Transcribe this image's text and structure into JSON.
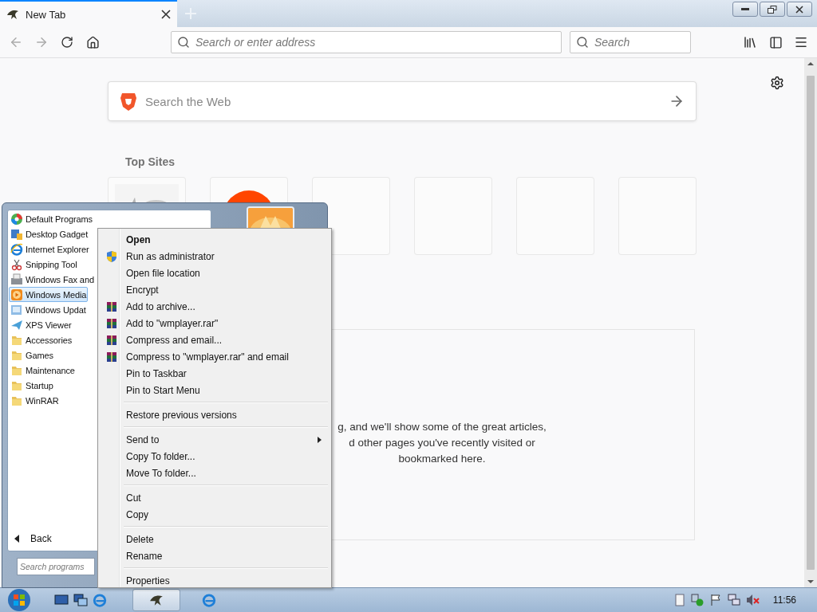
{
  "browser": {
    "tab": {
      "title": "New Tab",
      "selected": true
    },
    "address": {
      "placeholder": "Search or enter address"
    },
    "search": {
      "placeholder": "Search"
    },
    "web_search": {
      "placeholder": "Search the Web"
    },
    "top_sites": {
      "heading": "Top Sites",
      "tiles": [
        {
          "kind": "picture"
        },
        {
          "kind": "logo"
        },
        {
          "kind": "empty"
        },
        {
          "kind": "empty"
        },
        {
          "kind": "empty"
        },
        {
          "kind": "empty"
        }
      ]
    },
    "highlights": {
      "lines": [
        "g, and we'll show some of the great articles,",
        "d other pages you've recently visited or",
        "bookmarked here."
      ]
    }
  },
  "start_menu": {
    "programs": [
      {
        "label": "Default Programs",
        "kind": "default",
        "selected": false
      },
      {
        "label": "Desktop Gadget",
        "kind": "gadget",
        "selected": false
      },
      {
        "label": "Internet Explorer",
        "kind": "ie",
        "selected": false
      },
      {
        "label": "Snipping Tool",
        "kind": "snip",
        "selected": false
      },
      {
        "label": "Windows Fax and",
        "kind": "fax",
        "selected": false
      },
      {
        "label": "Windows Media",
        "kind": "media",
        "selected": true
      },
      {
        "label": "Windows Updat",
        "kind": "update",
        "selected": false
      },
      {
        "label": "XPS Viewer",
        "kind": "xps",
        "selected": false
      },
      {
        "label": "Accessories",
        "kind": "folder",
        "selected": false
      },
      {
        "label": "Games",
        "kind": "folder",
        "selected": false
      },
      {
        "label": "Maintenance",
        "kind": "folder",
        "selected": false
      },
      {
        "label": "Startup",
        "kind": "folder",
        "selected": false
      },
      {
        "label": "WinRAR",
        "kind": "folder",
        "selected": false
      }
    ],
    "back": "Back",
    "search": {
      "placeholder": "Search programs"
    }
  },
  "context_menu": {
    "groups": [
      [
        {
          "label": "Open",
          "kind": "plain",
          "default": true,
          "submenu": false
        },
        {
          "label": "Run as administrator",
          "kind": "shield",
          "default": false,
          "submenu": false
        },
        {
          "label": "Open file location",
          "kind": "plain",
          "default": false,
          "submenu": false
        },
        {
          "label": "Encrypt",
          "kind": "plain",
          "default": false,
          "submenu": false
        },
        {
          "label": "Add to archive...",
          "kind": "archive",
          "default": false,
          "submenu": false
        },
        {
          "label": "Add to \"wmplayer.rar\"",
          "kind": "archive",
          "default": false,
          "submenu": false
        },
        {
          "label": "Compress and email...",
          "kind": "archive",
          "default": false,
          "submenu": false
        },
        {
          "label": "Compress to \"wmplayer.rar\" and email",
          "kind": "archive",
          "default": false,
          "submenu": false
        },
        {
          "label": "Pin to Taskbar",
          "kind": "plain",
          "default": false,
          "submenu": false
        },
        {
          "label": "Pin to Start Menu",
          "kind": "plain",
          "default": false,
          "submenu": false
        }
      ],
      [
        {
          "label": "Restore previous versions",
          "kind": "plain",
          "default": false,
          "submenu": false
        }
      ],
      [
        {
          "label": "Send to",
          "kind": "plain",
          "default": false,
          "submenu": true
        },
        {
          "label": "Copy To folder...",
          "kind": "plain",
          "default": false,
          "submenu": false
        },
        {
          "label": "Move To folder...",
          "kind": "plain",
          "default": false,
          "submenu": false
        }
      ],
      [
        {
          "label": "Cut",
          "kind": "plain",
          "default": false,
          "submenu": false
        },
        {
          "label": "Copy",
          "kind": "plain",
          "default": false,
          "submenu": false
        }
      ],
      [
        {
          "label": "Delete",
          "kind": "plain",
          "default": false,
          "submenu": false
        },
        {
          "label": "Rename",
          "kind": "plain",
          "default": false,
          "submenu": false
        }
      ],
      [
        {
          "label": "Properties",
          "kind": "plain",
          "default": false,
          "submenu": false
        }
      ]
    ]
  },
  "taskbar": {
    "tasks": [
      {
        "kind": "browser",
        "selected": true
      },
      {
        "kind": "ie",
        "selected": false
      }
    ],
    "clock": "11:56"
  }
}
